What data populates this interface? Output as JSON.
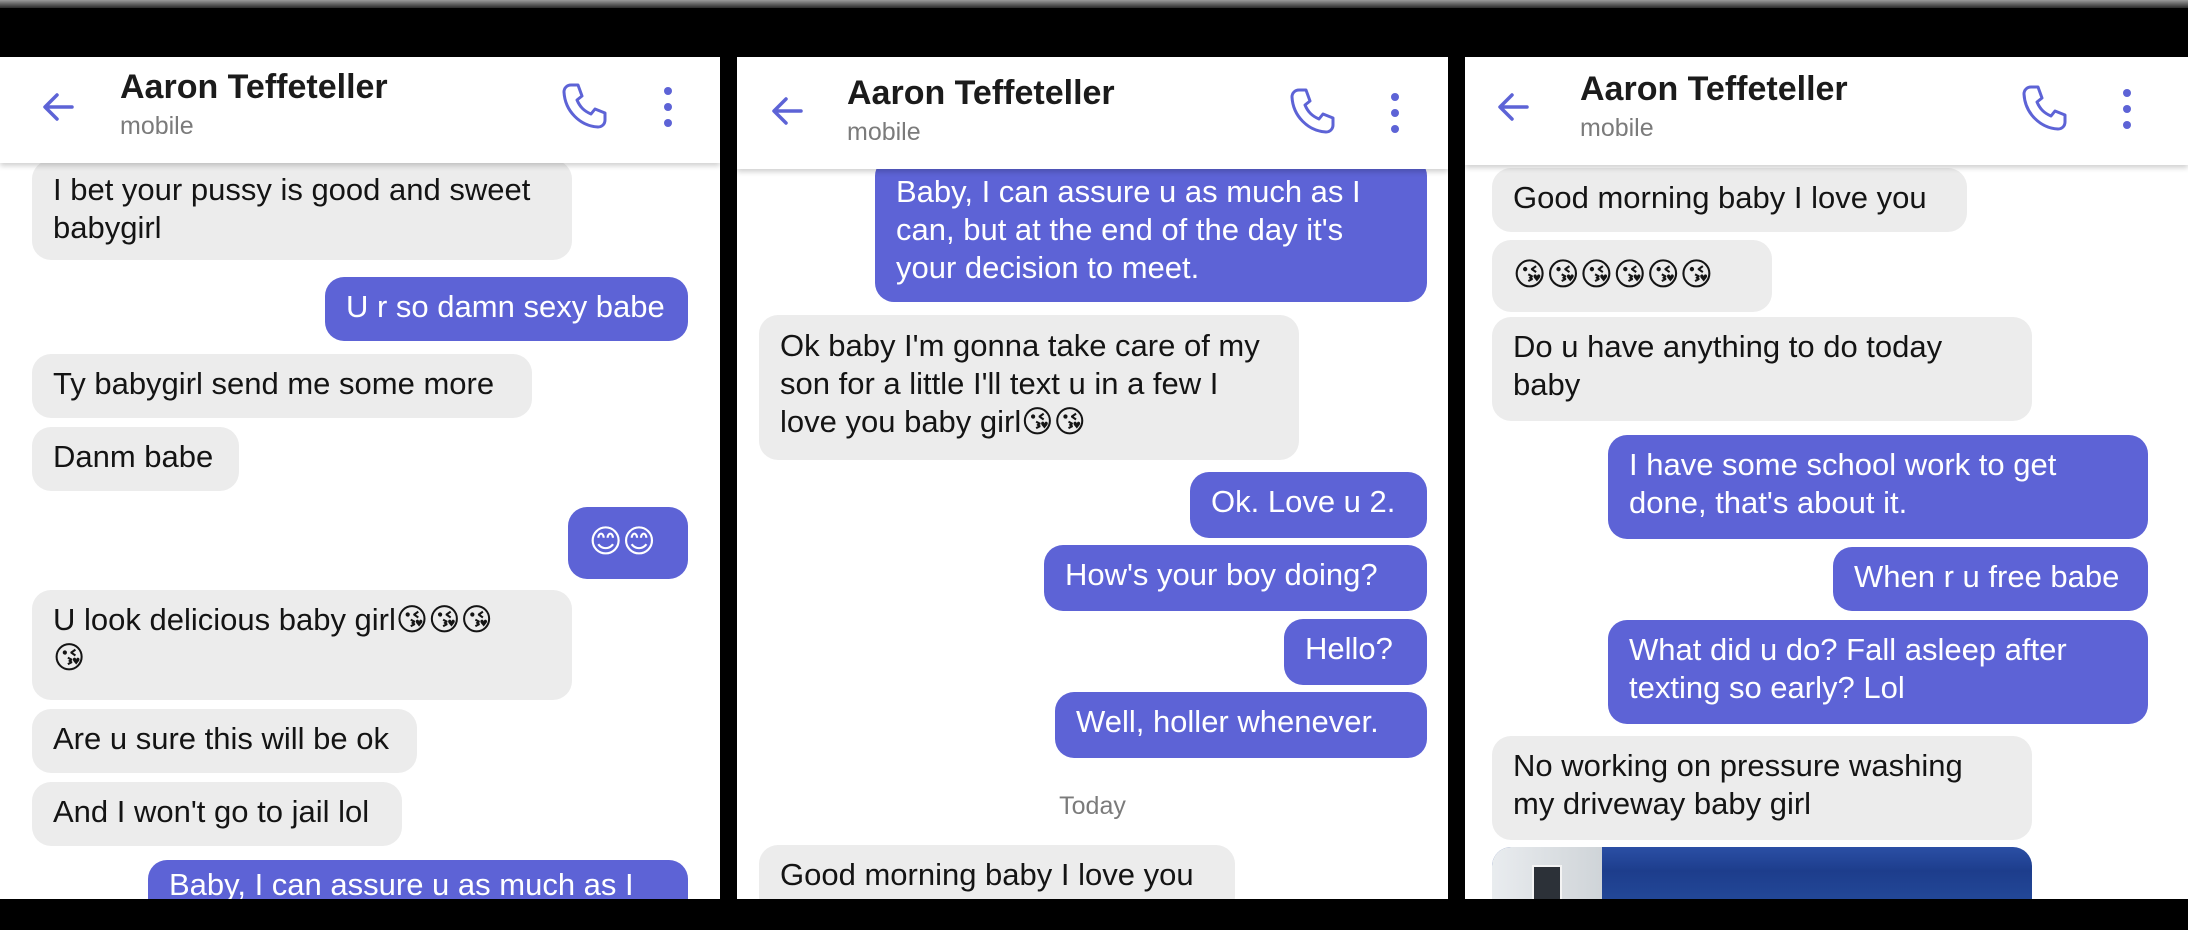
{
  "screens": [
    {
      "contact_name": "Aaron Teffeteller",
      "contact_type": "mobile",
      "messages": [
        {
          "dir": "in",
          "text": "I bet your pussy is good and sweet\nbabygirl"
        },
        {
          "dir": "out",
          "text": "U r so damn sexy babe"
        },
        {
          "dir": "in",
          "text": "Ty babygirl send me some more"
        },
        {
          "dir": "in",
          "text": "Danm babe"
        },
        {
          "dir": "out",
          "text": "😊😊"
        },
        {
          "dir": "in",
          "text": "U look delicious baby girl😘😘😘\n😘"
        },
        {
          "dir": "in",
          "text": "Are u sure this will be ok"
        },
        {
          "dir": "in",
          "text": "And I won't go to jail lol"
        },
        {
          "dir": "out",
          "text": "Baby, I can assure u as much as I"
        }
      ]
    },
    {
      "contact_name": "Aaron Teffeteller",
      "contact_type": "mobile",
      "messages": [
        {
          "dir": "out",
          "text": "Baby, I can assure u as much as I\ncan, but at the end of the day it's\nyour decision to meet."
        },
        {
          "dir": "in",
          "text": "Ok baby I'm gonna take care of my\nson for a little I'll text u in a few I\nlove you baby girl😘😘"
        },
        {
          "dir": "out",
          "text": "Ok. Love u 2."
        },
        {
          "dir": "out",
          "text": "How's your boy doing?"
        },
        {
          "dir": "out",
          "text": "Hello?"
        },
        {
          "dir": "out",
          "text": "Well, holler whenever."
        },
        {
          "dir": "date",
          "text": "Today"
        },
        {
          "dir": "in",
          "text": "Good morning baby I love you"
        }
      ]
    },
    {
      "contact_name": "Aaron Teffeteller",
      "contact_type": "mobile",
      "messages": [
        {
          "dir": "in",
          "text": "Good morning baby I love you"
        },
        {
          "dir": "in",
          "text": "😘😘😘😘😘😘"
        },
        {
          "dir": "in",
          "text": "Do u have anything to do today\nbaby"
        },
        {
          "dir": "out",
          "text": "I have some school work to get\ndone, that's about it."
        },
        {
          "dir": "out",
          "text": "When r u free babe"
        },
        {
          "dir": "out",
          "text": "What did u do? Fall asleep after\ntexting so early? Lol"
        },
        {
          "dir": "in",
          "text": "No working on pressure washing\nmy driveway baby girl"
        }
      ]
    }
  ],
  "colors": {
    "accent": "#5d63d6",
    "incoming_bubble": "#ececec",
    "outgoing_text": "#ffffff"
  },
  "icons": [
    "back-arrow-icon",
    "phone-icon",
    "more-vert-icon"
  ]
}
